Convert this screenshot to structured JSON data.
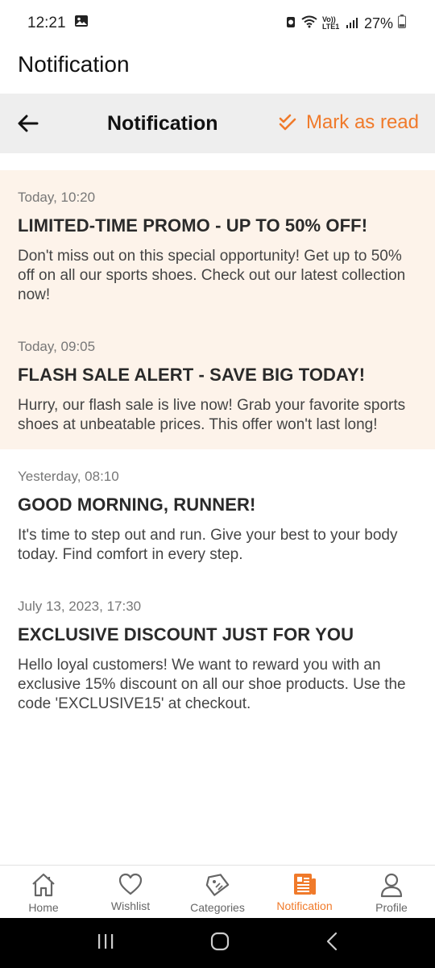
{
  "status_bar": {
    "time": "12:21",
    "battery": "27%",
    "network": "VoLTE LTE1"
  },
  "app_title": "Notification",
  "header": {
    "title": "Notification",
    "mark_read_label": "Mark as read"
  },
  "notifications": [
    {
      "time": "Today, 10:20",
      "title": "LIMITED-TIME PROMO - UP TO 50% OFF!",
      "body": "Don't miss out on this special opportunity! Get up to 50% off on all our sports shoes. Check out our latest collection now!",
      "unread": true
    },
    {
      "time": "Today, 09:05",
      "title": "FLASH SALE ALERT - SAVE BIG TODAY!",
      "body": "Hurry, our flash sale is live now! Grab your favorite sports shoes at unbeatable prices. This offer won't last long!",
      "unread": true
    },
    {
      "time": "Yesterday, 08:10",
      "title": "GOOD MORNING, RUNNER!",
      "body": "It's time to step out and run. Give your best to your body today. Find comfort in every step.",
      "unread": false
    },
    {
      "time": "July 13, 2023, 17:30",
      "title": "EXCLUSIVE DISCOUNT JUST FOR YOU",
      "body": "Hello loyal customers! We want to reward you with an exclusive 15% discount on all our shoe products. Use the code 'EXCLUSIVE15' at checkout.",
      "unread": false
    }
  ],
  "bottom_nav": [
    {
      "label": "Home",
      "icon": "home-icon",
      "active": false
    },
    {
      "label": "Wishlist",
      "icon": "heart-icon",
      "active": false
    },
    {
      "label": "Categories",
      "icon": "tag-icon",
      "active": false
    },
    {
      "label": "Notification",
      "icon": "newspaper-icon",
      "active": true
    },
    {
      "label": "Profile",
      "icon": "user-icon",
      "active": false
    }
  ],
  "colors": {
    "accent": "#f07a2a",
    "unread_bg": "#fdf3ea",
    "header_bg": "#eeeeee"
  }
}
